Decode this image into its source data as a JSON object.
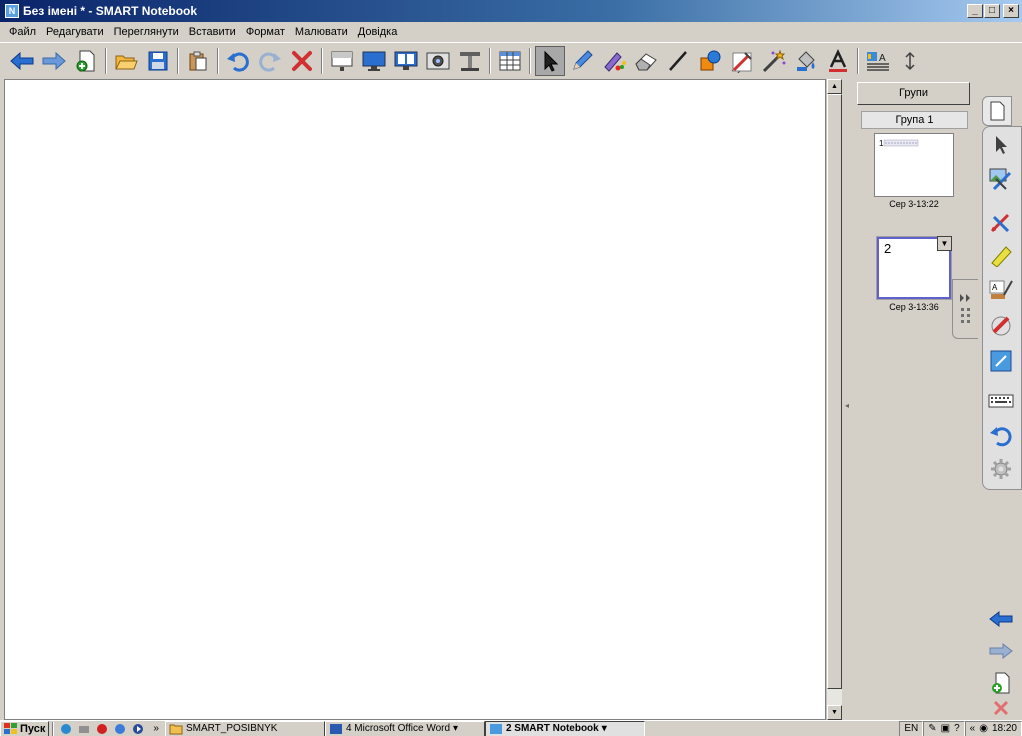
{
  "window": {
    "title": "Без імені * - SMART Notebook",
    "controls": {
      "minimize": "_",
      "maximize": "□",
      "close": "×"
    }
  },
  "menu": [
    {
      "label": "Файл"
    },
    {
      "label": "Редагувати"
    },
    {
      "label": "Переглянути"
    },
    {
      "label": "Вставити"
    },
    {
      "label": "Формат"
    },
    {
      "label": "Малювати"
    },
    {
      "label": "Довідка"
    }
  ],
  "toolbar": {
    "selected_tool": "select-arrow",
    "buttons": [
      "back-arrow",
      "forward-arrow",
      "add-page",
      "open-folder",
      "save",
      "paste",
      "undo",
      "redo",
      "delete",
      "screen-shade",
      "full-screen",
      "dual-page",
      "screen-capture",
      "doc-camera",
      "table",
      "select",
      "pen",
      "creative-pen",
      "eraser",
      "line",
      "shapes",
      "magic-pen",
      "fill",
      "text",
      "properties",
      "move-toolbar"
    ]
  },
  "side_panel": {
    "groups_button": "Групи",
    "group_header": "Група 1",
    "pages": [
      {
        "caption": "Сер 3-13:22"
      },
      {
        "number": "2",
        "caption": "Сер 3-13:36"
      }
    ]
  },
  "taskbar": {
    "start": "Пуск",
    "quick_launch_more": "»",
    "tasks": [
      {
        "label": "SMART_POSIBNYK"
      },
      {
        "label": "4 Microsoft Office Word"
      },
      {
        "label": "2 SMART Notebook"
      }
    ],
    "lang": "EN",
    "tray_more": "«",
    "clock": "18:20"
  },
  "colors": {
    "title_bar_start": "#0a246a",
    "title_bar_end": "#a6caf0",
    "chrome": "#d4d0c8",
    "canvas": "#ffffff",
    "tool_blue": "#2a6ed0",
    "tool_red": "#d03030",
    "tool_orange": "#f08a10"
  }
}
